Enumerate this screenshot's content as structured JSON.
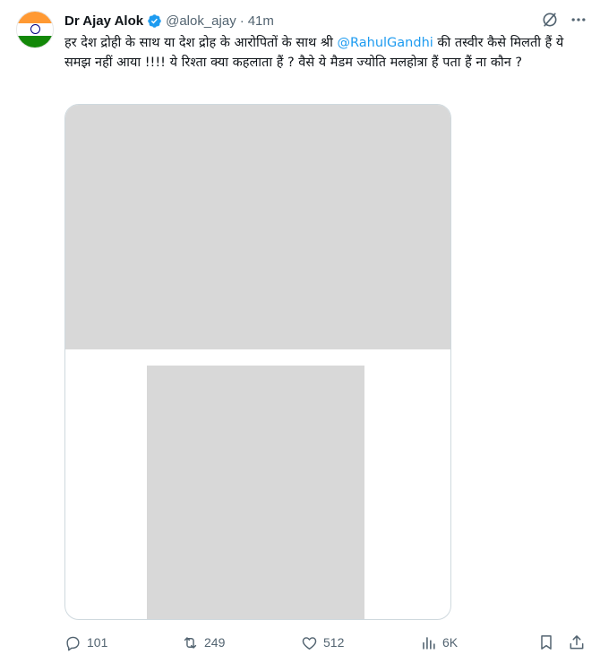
{
  "author": {
    "name": "Dr Ajay Alok",
    "handle": "@alok_ajay",
    "separator": "·",
    "time": "41m"
  },
  "tweet": {
    "text_before": "हर देश द्रोही के साथ या देश द्रोह के आरोपितों के साथ श्री ",
    "mention": "@RahulGandhi",
    "text_after": " की तस्वीर कैसे मिलती हैं ये समझ नहीं आया !!!! ये रिश्ता क्या कहलाता हैं ? वैसे ये मैडम ज्योति मलहोत्रा हैं पता हैं ना कौन ?"
  },
  "actions": {
    "replies": "101",
    "reposts": "249",
    "likes": "512",
    "views": "6K"
  },
  "icons": {
    "avatar": "indian-flag-avatar",
    "verified": "verified-badge-icon",
    "grok": "grok-icon",
    "more": "more-icon",
    "reply": "reply-icon",
    "repost": "repost-icon",
    "like": "heart-icon",
    "views": "views-chart-icon",
    "bookmark": "bookmark-icon",
    "share": "share-icon"
  },
  "colors": {
    "text": "#0f1419",
    "secondary": "#536471",
    "link": "#1d9bf0",
    "border": "#cfd9de"
  }
}
